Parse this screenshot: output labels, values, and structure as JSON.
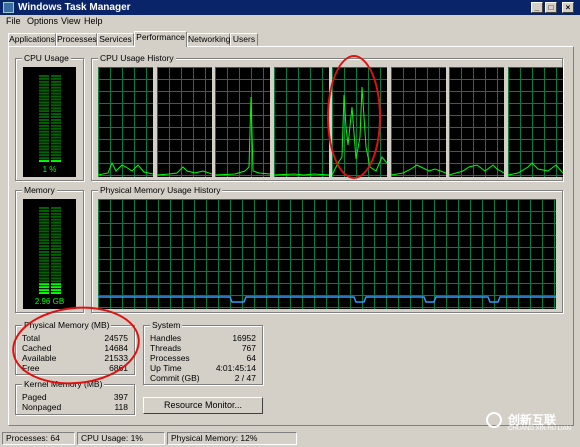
{
  "window": {
    "title": "Windows Task Manager"
  },
  "menu": [
    {
      "label": "File"
    },
    {
      "label": "Options"
    },
    {
      "label": "View"
    },
    {
      "label": "Help"
    }
  ],
  "tabs": [
    {
      "label": "Applications"
    },
    {
      "label": "Processes"
    },
    {
      "label": "Services"
    },
    {
      "label": "Performance",
      "selected": true
    },
    {
      "label": "Networking"
    },
    {
      "label": "Users"
    }
  ],
  "cpu_usage": {
    "label": "CPU Usage",
    "value_text": "1 %",
    "level": 0.01
  },
  "cpu_history": {
    "label": "CPU Usage History",
    "core_count": 8
  },
  "memory": {
    "label": "Memory",
    "value_text": "2.96 GB",
    "level": 0.12
  },
  "memory_history": {
    "label": "Physical Memory Usage History"
  },
  "physical_memory": {
    "label": "Physical Memory (MB)",
    "rows": [
      {
        "key": "Total",
        "value": "24575"
      },
      {
        "key": "Cached",
        "value": "14684"
      },
      {
        "key": "Available",
        "value": "21533"
      },
      {
        "key": "Free",
        "value": "6861"
      }
    ]
  },
  "kernel_memory": {
    "label": "Kernel Memory (MB)",
    "rows": [
      {
        "key": "Paged",
        "value": "397"
      },
      {
        "key": "Nonpaged",
        "value": "118"
      }
    ]
  },
  "system": {
    "label": "System",
    "rows": [
      {
        "key": "Handles",
        "value": "16952"
      },
      {
        "key": "Threads",
        "value": "767"
      },
      {
        "key": "Processes",
        "value": "64"
      },
      {
        "key": "Up Time",
        "value": "4:01:45:14"
      },
      {
        "key": "Commit (GB)",
        "value": "2 / 47"
      }
    ]
  },
  "resource_monitor_button": "Resource Monitor...",
  "status": {
    "processes": "Processes: 64",
    "cpu": "CPU Usage: 1%",
    "memory": "Physical Memory: 12%"
  },
  "watermark": {
    "name": "创新互联",
    "tagline": "CHUANG XIN HU LIAN"
  },
  "colors": {
    "graph_line": "#00ff00",
    "grid": "#008040",
    "memory_line": "#3399ff",
    "annotation": "#e01010"
  }
}
